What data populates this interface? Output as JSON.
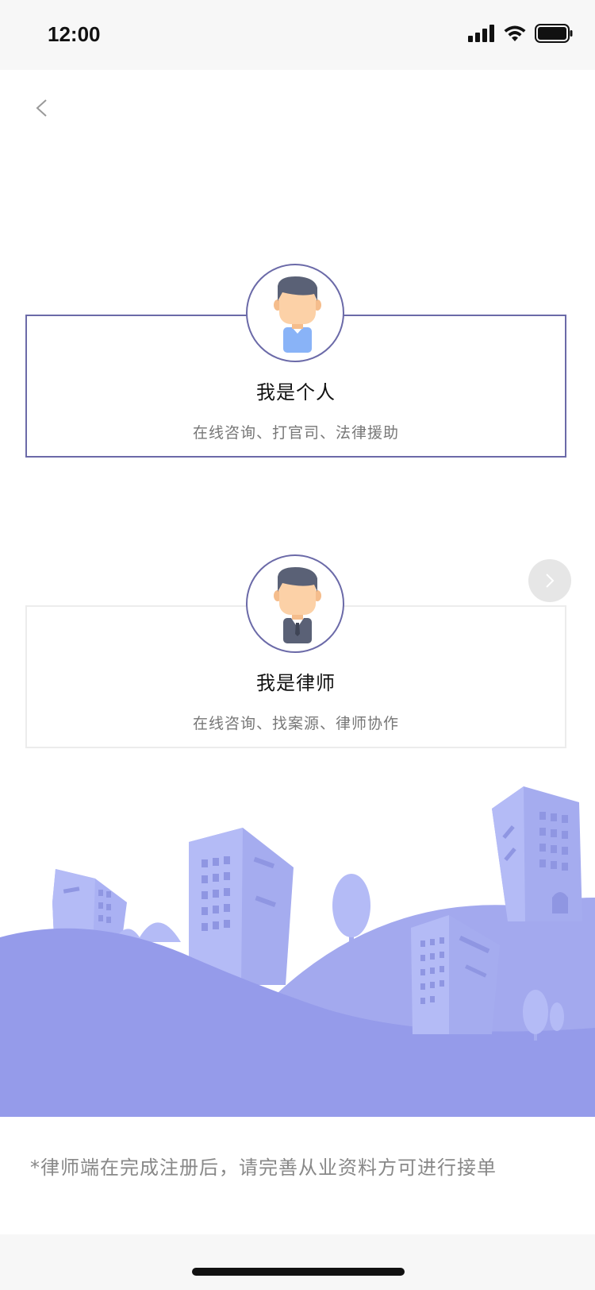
{
  "status_bar": {
    "time": "12:00",
    "icons": [
      "signal-icon",
      "wifi-icon",
      "battery-icon"
    ]
  },
  "nav": {
    "back_icon": "chevron-left-icon"
  },
  "options": [
    {
      "title": "我是个人",
      "subtitle": "在线咨询、打官司、法律援助",
      "avatar_icon": "person-avatar-icon",
      "selected": true
    },
    {
      "title": "我是律师",
      "subtitle": "在线咨询、找案源、律师协作",
      "avatar_icon": "lawyer-avatar-icon",
      "selected": false
    }
  ],
  "next_icon": "chevron-right-icon",
  "footer_note": "*律师端在完成注册后，请完善从业资料方可进行接单",
  "colors": {
    "accent": "#6b6aa8",
    "illustration_primary": "#959bea",
    "illustration_light": "#b0b6f4",
    "skin": "#fcd1a7",
    "hair": "#5a6176"
  }
}
